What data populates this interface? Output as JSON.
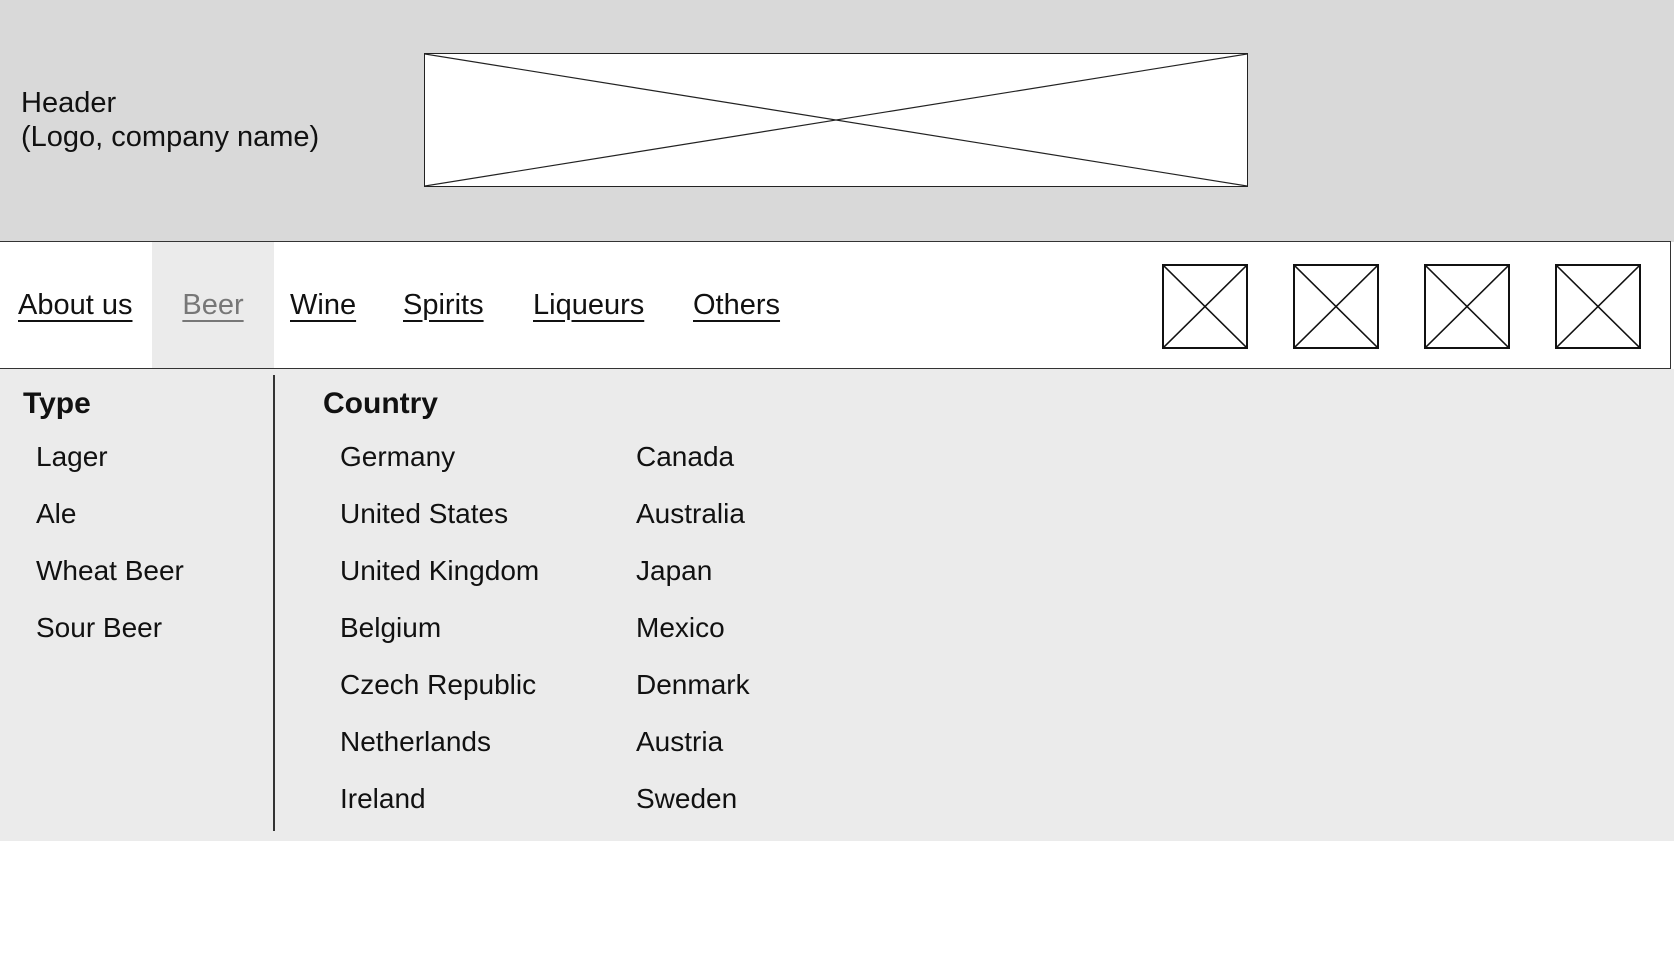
{
  "header": {
    "line1": "Header",
    "line2": "(Logo, company name)",
    "logo_placeholder": "image-placeholder-icon"
  },
  "nav": {
    "links": [
      {
        "label": "About us",
        "active": false
      },
      {
        "label": "Beer",
        "active": true
      },
      {
        "label": "Wine",
        "active": false
      },
      {
        "label": "Spirits",
        "active": false
      },
      {
        "label": "Liqueurs",
        "active": false
      },
      {
        "label": "Others",
        "active": false
      }
    ],
    "icons": [
      "image-placeholder-icon",
      "image-placeholder-icon",
      "image-placeholder-icon",
      "image-placeholder-icon"
    ]
  },
  "dropdown": {
    "type": {
      "title": "Type",
      "items": [
        "Lager",
        "Ale",
        "Wheat Beer",
        "Sour Beer"
      ]
    },
    "country": {
      "title": "Country",
      "col1": [
        "Germany",
        "United States",
        "United Kingdom",
        "Belgium",
        "Czech Republic",
        "Netherlands",
        "Ireland"
      ],
      "col2": [
        "Canada",
        "Australia",
        "Japan",
        "Mexico",
        "Denmark",
        "Austria",
        "Sweden"
      ]
    }
  },
  "colors": {
    "header_bg": "#d9d9d9",
    "dropdown_bg": "#ebebeb",
    "active_text": "#777777"
  }
}
